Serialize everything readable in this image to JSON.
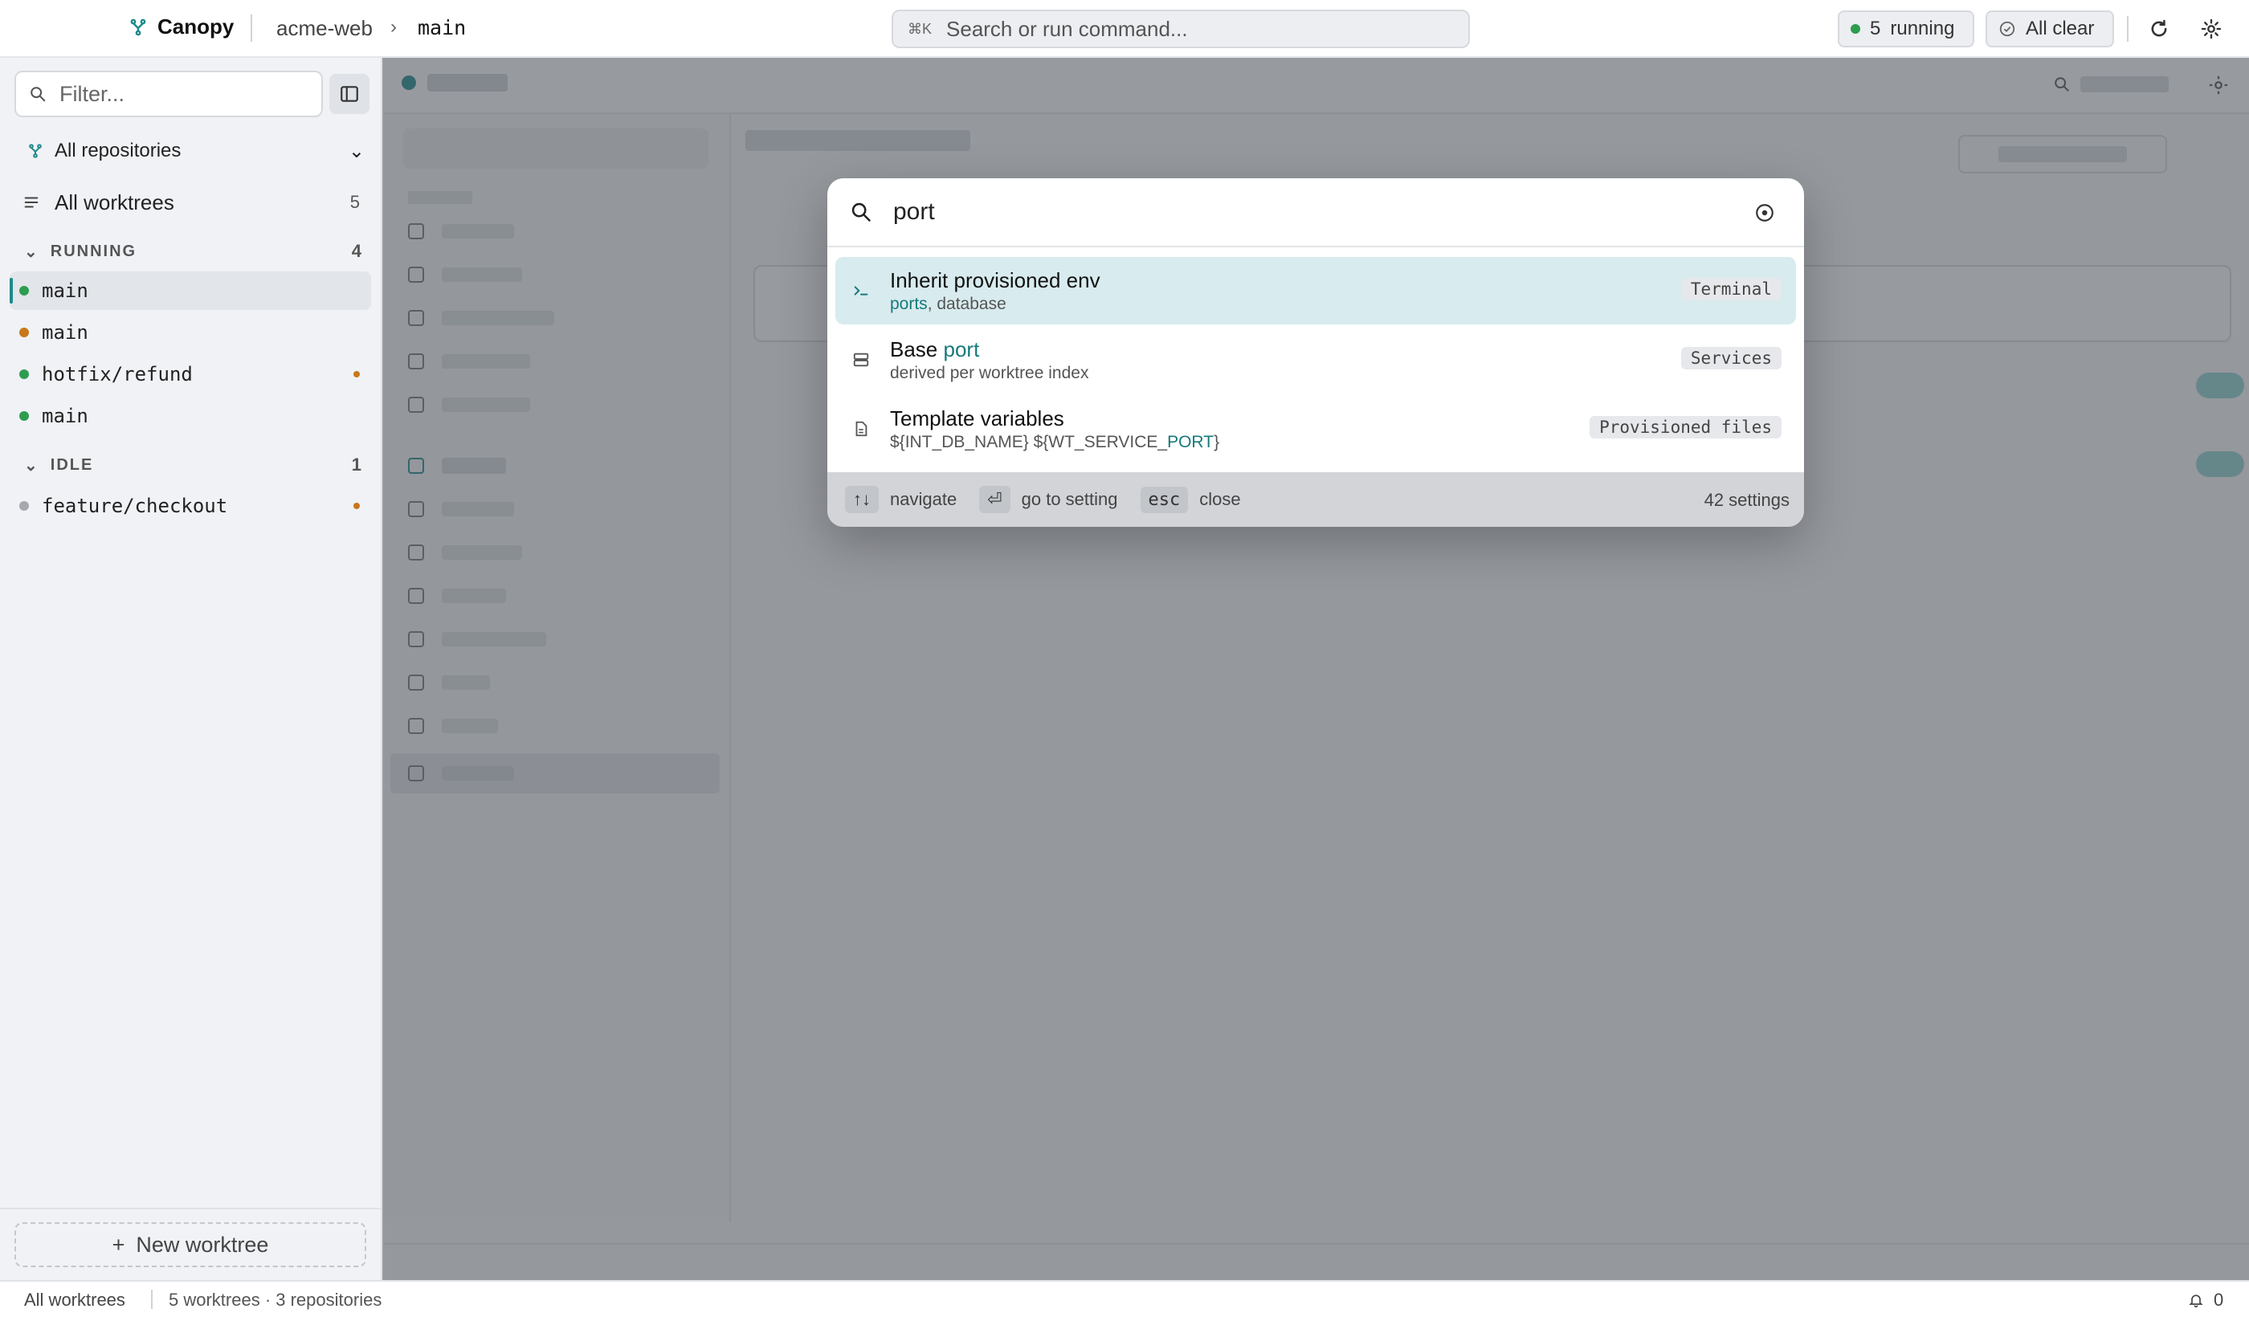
{
  "topbar": {
    "app_name": "Canopy",
    "repo": "acme-web",
    "branch": "main",
    "command_shortcut": "⌘K",
    "command_placeholder": "Search or run command...",
    "running_count": "5",
    "running_label": "running",
    "status_label": "All clear",
    "icons": [
      "canopy-logo-icon",
      "refresh-icon",
      "gear-icon"
    ]
  },
  "sidebar": {
    "filter_placeholder": "Filter...",
    "repo_selector": "All repositories",
    "all_worktrees_label": "All worktrees",
    "all_worktrees_count": "5",
    "groups": [
      {
        "label": "RUNNING",
        "count": "4",
        "items": [
          {
            "name": "main",
            "status": "green",
            "active": true,
            "flag": false
          },
          {
            "name": "main",
            "status": "orange",
            "active": false,
            "flag": false
          },
          {
            "name": "hotfix/refund",
            "status": "green",
            "active": false,
            "flag": true
          },
          {
            "name": "main",
            "status": "green",
            "active": false,
            "flag": false
          }
        ]
      },
      {
        "label": "IDLE",
        "count": "1",
        "items": [
          {
            "name": "feature/checkout",
            "status": "gray",
            "active": false,
            "flag": true
          }
        ]
      }
    ],
    "new_worktree_label": "New worktree"
  },
  "statusbar": {
    "left": "All worktrees",
    "summary": "5 worktrees · 3 repositories",
    "notifications": "0"
  },
  "palette": {
    "query": "port",
    "results": [
      {
        "title": "Inherit provisioned env",
        "subtitle_parts": [
          {
            "text": "ports",
            "hl": true
          },
          {
            "text": ", database",
            "hl": false
          }
        ],
        "tag": "Terminal",
        "icon": "terminal-icon",
        "selected": true
      },
      {
        "title_parts": [
          {
            "text": "Base ",
            "hl": false
          },
          {
            "text": "port",
            "hl": true
          }
        ],
        "subtitle": "derived per worktree index",
        "tag": "Services",
        "icon": "server-icon",
        "selected": false
      },
      {
        "title": "Template variables",
        "subtitle_parts": [
          {
            "text": "${INT_DB_NAME} ${WT_SERVICE_",
            "hl": false
          },
          {
            "text": "PORT",
            "hl": true
          },
          {
            "text": "}",
            "hl": false
          }
        ],
        "tag": "Provisioned files",
        "icon": "file-icon",
        "selected": false
      }
    ],
    "footer": {
      "navigate_key": "↑↓",
      "navigate_label": "navigate",
      "enter_key": "⏎",
      "enter_label": "go to setting",
      "esc_key": "esc",
      "esc_label": "close",
      "count_label": "42 settings"
    }
  }
}
